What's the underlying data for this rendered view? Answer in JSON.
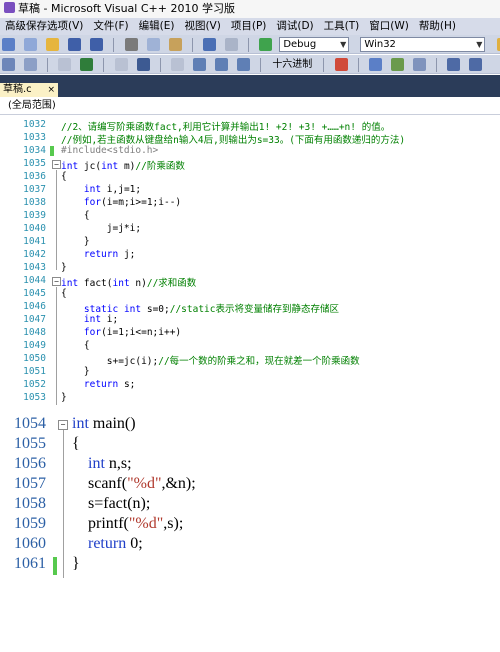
{
  "window": {
    "title": "草稿 - Microsoft Visual C++ 2010 学习版"
  },
  "menubar": {
    "items": [
      "高级保存选项(V)",
      "文件(F)",
      "编辑(E)",
      "视图(V)",
      "项目(P)",
      "调试(D)",
      "工具(T)",
      "窗口(W)",
      "帮助(H)"
    ]
  },
  "toolbar": {
    "config_value": "Debug",
    "platform_value": "Win32",
    "hex_label": "十六进制"
  },
  "tabs": [
    {
      "label": "草稿.c",
      "close": "×"
    }
  ],
  "scope": {
    "label": "(全局范围)"
  },
  "editor_top": {
    "lines": [
      {
        "num": "1032",
        "text": "//2、请编写阶乘函数fact,利用它计算并输出1! +2! +3! +……+n! 的值。"
      },
      {
        "num": "1033",
        "text": "//例如,若主函数从键盘给n输入4后,则输出为s=33。(下面有用函数递归的方法)"
      },
      {
        "num": "1034",
        "text": "#include<stdio.h>"
      },
      {
        "num": "1035",
        "text": "int jc(int m)//阶乘函数"
      },
      {
        "num": "1036",
        "text": "{"
      },
      {
        "num": "1037",
        "text": "    int i,j=1;"
      },
      {
        "num": "1038",
        "text": "    for(i=m;i>=1;i--)"
      },
      {
        "num": "1039",
        "text": "    {"
      },
      {
        "num": "1040",
        "text": "        j=j*i;"
      },
      {
        "num": "1041",
        "text": "    }"
      },
      {
        "num": "1042",
        "text": "    return j;"
      },
      {
        "num": "1043",
        "text": "}"
      },
      {
        "num": "1044",
        "text": "int fact(int n)//求和函数"
      },
      {
        "num": "1045",
        "text": "{"
      },
      {
        "num": "1046",
        "text": "    static int s=0;//static表示将变量储存到静态存储区"
      },
      {
        "num": "1047",
        "text": "    int i;"
      },
      {
        "num": "1048",
        "text": "    for(i=1;i<=n;i++)"
      },
      {
        "num": "1049",
        "text": "    {"
      },
      {
        "num": "1050",
        "text": "        s+=jc(i);//每一个数的阶乘之和，现在就差一个阶乘函数"
      },
      {
        "num": "1051",
        "text": "    }"
      },
      {
        "num": "1052",
        "text": "    return s;"
      },
      {
        "num": "1053",
        "text": "}"
      }
    ]
  },
  "editor_bottom": {
    "lines": [
      {
        "num": "1054",
        "text": "int main()"
      },
      {
        "num": "1055",
        "text": "{"
      },
      {
        "num": "1056",
        "text": "    int n,s;"
      },
      {
        "num": "1057",
        "text": "    scanf(\"%d\",&n);"
      },
      {
        "num": "1058",
        "text": "    s=fact(n);"
      },
      {
        "num": "1059",
        "text": "    printf(\"%d\",s);"
      },
      {
        "num": "1060",
        "text": "    return 0;"
      },
      {
        "num": "1061",
        "text": "}"
      }
    ]
  },
  "colors": {
    "keyword": "#0000ff",
    "comment": "#008000",
    "preprocessor": "#808080",
    "line_number": "#2b91af",
    "changed_bar": "#57c94e",
    "tab_active": "#fbf1c6",
    "ide_frame": "#2b3c59"
  }
}
